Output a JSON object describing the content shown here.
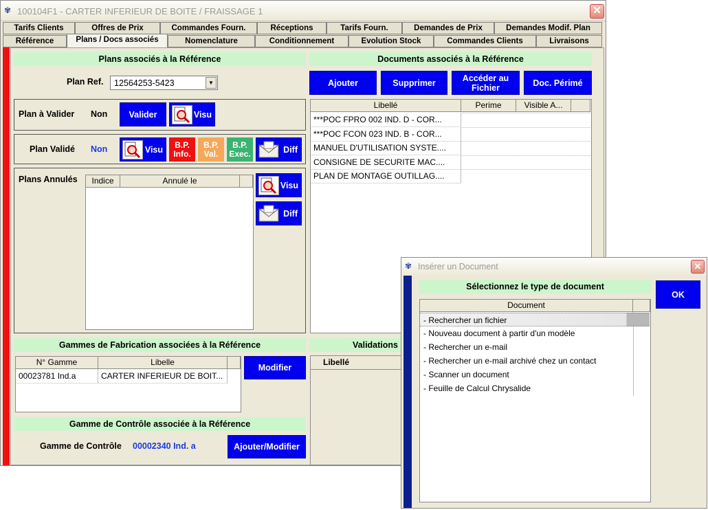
{
  "window": {
    "title": "100104F1 - CARTER INFERIEUR DE BOITE / FRAISSAGE 1",
    "close": "✕"
  },
  "tabs_row1": [
    "Tarifs Clients",
    "Offres de Prix",
    "Commandes Fourn.",
    "Réceptions",
    "Tarifs Fourn.",
    "Demandes de Prix",
    "Demandes Modif. Plan"
  ],
  "tabs_row2": [
    "Référence",
    "Plans / Docs associés",
    "Nomenclature",
    "Conditionnement",
    "Evolution Stock",
    "Commandes Clients",
    "Livraisons"
  ],
  "plans": {
    "header": "Plans associés à la Référence",
    "plan_ref_label": "Plan Ref.",
    "plan_ref_value": "12564253-5423",
    "a_valider_label": "Plan à Valider",
    "a_valider_value": "Non",
    "valider_btn": "Valider",
    "visu_btn": "Visu",
    "valide_label": "Plan Validé",
    "valide_value": "Non",
    "bp_info": [
      "B.P.",
      "Info."
    ],
    "bp_val": [
      "B.P.",
      "Val."
    ],
    "bp_exec": [
      "B.P.",
      "Exec."
    ],
    "diff_btn": "Diff",
    "annules_label": "Plans Annulés",
    "annules_cols": [
      "Indice",
      "Annulé le"
    ]
  },
  "documents": {
    "header": "Documents associés à la Référence",
    "buttons": {
      "ajouter": "Ajouter",
      "supprimer": "Supprimer",
      "acceder": [
        "Accéder au",
        "Fichier"
      ],
      "perime": "Doc. Périmé"
    },
    "columns": [
      "Libellé",
      "Perime",
      "Visible A..."
    ],
    "rows": [
      {
        "libelle": "***POC FPRO 002 IND. D - COR...",
        "perime": "",
        "visible": true
      },
      {
        "libelle": "***POC FCON 023 IND. B - COR...",
        "perime": "",
        "visible": true
      },
      {
        "libelle": "MANUEL D'UTILISATION SYSTE....",
        "perime": "",
        "visible": true
      },
      {
        "libelle": "CONSIGNE DE SECURITE MAC....",
        "perime": "",
        "visible": true
      },
      {
        "libelle": "PLAN DE MONTAGE OUTILLAG....",
        "perime": "",
        "visible": true
      }
    ]
  },
  "gammes": {
    "header": "Gammes de Fabrication associées à la Référence",
    "columns": [
      "N° Gamme",
      "Libelle"
    ],
    "rows": [
      {
        "num": "00023781 Ind.a",
        "libelle": "CARTER INFERIEUR DE BOIT..."
      }
    ],
    "modifier_btn": "Modifier"
  },
  "validations": {
    "header": "Validations",
    "col": "Libellé"
  },
  "controle": {
    "header": "Gamme de Contrôle associée à la Référence",
    "label": "Gamme de Contrôle",
    "value": "00002340 Ind. a",
    "btn": "Ajouter/Modifier"
  },
  "dialog": {
    "title": "Insérer un Document",
    "close": "✕",
    "header": "Sélectionnez le type de document",
    "ok": "OK",
    "column": "Document",
    "items": [
      "- Rechercher un fichier",
      "- Nouveau document à partir d'un modèle",
      "- Rechercher un e-mail",
      "- Rechercher un e-mail archivé chez un contact",
      "- Scanner un document",
      "- Feuille de Calcul Chrysalide"
    ]
  },
  "colors": {
    "accent_blue": "#0000ee",
    "header_green": "#ccf5cc",
    "bp_info": "#ee1111",
    "bp_val": "#f5a85a",
    "bp_exec": "#3cb371",
    "red_bar": "#ee1111"
  }
}
